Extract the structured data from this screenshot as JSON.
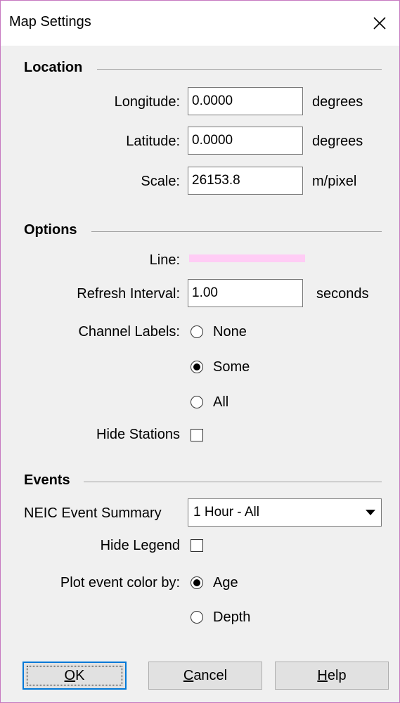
{
  "window": {
    "title": "Map Settings"
  },
  "location": {
    "title": "Location",
    "longitude": {
      "label": "Longitude:",
      "value": "0.0000",
      "unit": "degrees"
    },
    "latitude": {
      "label": "Latitude:",
      "value": "0.0000",
      "unit": "degrees"
    },
    "scale": {
      "label": "Scale:",
      "value": "26153.8",
      "unit": "m/pixel"
    }
  },
  "options": {
    "title": "Options",
    "line": {
      "label": "Line:",
      "color": "#ffccf5"
    },
    "refresh": {
      "label": "Refresh Interval:",
      "value": "1.00",
      "unit": "seconds"
    },
    "channel_labels": {
      "label": "Channel Labels:",
      "options": [
        "None",
        "Some",
        "All"
      ],
      "selected": "Some"
    },
    "hide_stations": {
      "label": "Hide Stations",
      "checked": false
    }
  },
  "events": {
    "title": "Events",
    "neic": {
      "label": "NEIC Event Summary",
      "selected": "1 Hour - All"
    },
    "hide_legend": {
      "label": "Hide Legend",
      "checked": false
    },
    "color_by": {
      "label": "Plot event color by:",
      "options": [
        "Age",
        "Depth"
      ],
      "selected": "Age"
    }
  },
  "buttons": {
    "ok": {
      "pre": "",
      "mnemonic": "O",
      "post": "K"
    },
    "cancel": {
      "pre": "",
      "mnemonic": "C",
      "post": "ancel"
    },
    "help": {
      "pre": "",
      "mnemonic": "H",
      "post": "elp"
    }
  },
  "colors": {
    "accent": "#0078d7",
    "window_border": "#c678c0",
    "dialog_bg": "#f0f0f0"
  }
}
